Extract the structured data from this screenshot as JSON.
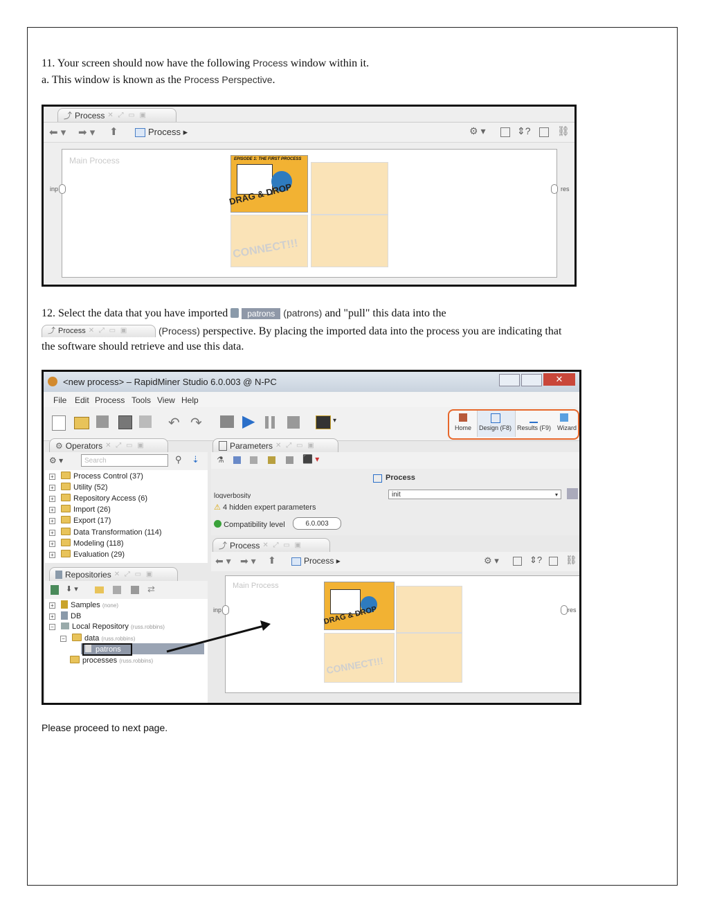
{
  "step11": {
    "line1_pre": "11. Your screen should now have the following ",
    "line1_ui": "Process",
    "line1_post": " window within it.",
    "line2_pre": "a. This window is known as the ",
    "line2_ui": "Process Perspective",
    "line2_post": "."
  },
  "shot1": {
    "tab_label": "Process",
    "breadcrumb": "Process",
    "canvas_title": "Main Process",
    "port_in": "inp",
    "port_out": "res",
    "comic_header": "EPISODE 1: THE FIRST PROCESS",
    "comic_text1": "DRAG & DROP",
    "comic_text2": "CONNECT!!!"
  },
  "step12": {
    "line1_pre": "12. Select the data that you have imported ",
    "chip": "patrons",
    "line1_ui": "(patrons)",
    "line1_post": " and \"pull\" this data into the",
    "tab_chip": "Process",
    "line2_ui": "(Process)",
    "line2_post": " perspective. By placing the imported data into the process you are indicating that",
    "line3": "the software should retrieve and use this data."
  },
  "shot2": {
    "window_title": "<new process> – RapidMiner Studio 6.0.003 @ N-PC",
    "menu": [
      "File",
      "Edit",
      "Process",
      "Tools",
      "View",
      "Help"
    ],
    "perspectives": [
      "Home",
      "Design (F8)",
      "Results (F9)",
      "Wizard"
    ],
    "operators_tab": "Operators",
    "search_placeholder": "Search",
    "operator_tree": [
      "Process Control (37)",
      "Utility (52)",
      "Repository Access (6)",
      "Import (26)",
      "Export (17)",
      "Data Transformation (114)",
      "Modeling (118)",
      "Evaluation (29)"
    ],
    "parameters_tab": "Parameters",
    "param_header": "Process",
    "param_name": "logverbosity",
    "param_value": "init",
    "hidden_params": "4 hidden expert parameters",
    "compat_label": "Compatibility level",
    "compat_value": "6.0.003",
    "repositories_tab": "Repositories",
    "repo_tree": {
      "samples": "Samples",
      "samples_note": "(none)",
      "db": "DB",
      "local": "Local Repository",
      "local_note": "(russ.robbins)",
      "data": "data",
      "data_note": "(russ.robbins)",
      "patrons": "patrons",
      "processes": "processes",
      "processes_note": "(russ.robbins)"
    },
    "process_tab": "Process",
    "breadcrumb": "Process",
    "canvas_title": "Main Process",
    "port_in": "inp",
    "port_out": "res"
  },
  "footer": "Please proceed to next page.",
  "colors": {
    "comic_orange": "#f2b233",
    "accent_blue": "#2a6fc9",
    "perspective_border": "#e7672a"
  }
}
